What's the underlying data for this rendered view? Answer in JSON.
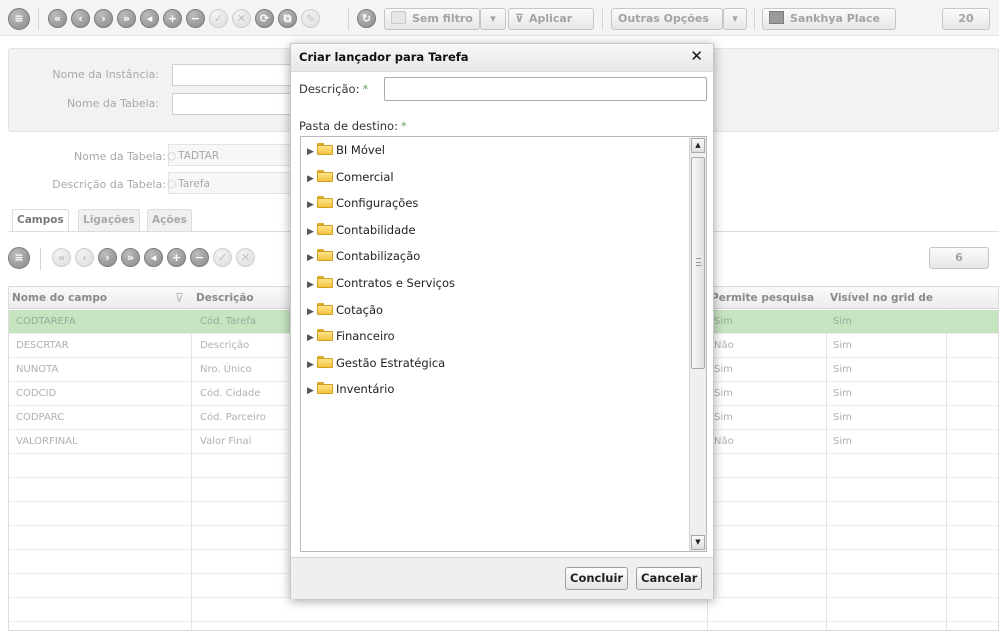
{
  "toolbar": {
    "filter_label": "Sem filtro",
    "apply_label": "Aplicar",
    "more_options_label": "Outras Opções",
    "place_label": "Sankhya Place",
    "page_size": "20"
  },
  "form": {
    "instance_name_label": "Nome da Instância:",
    "table_name_label": "Nome da Tabela:",
    "table_name_label2": "Nome da Tabela:",
    "table_name_value": "TADTAR",
    "table_desc_label": "Descrição da Tabela:",
    "table_desc_value": "Tarefa"
  },
  "tabs": [
    {
      "label": "Campos"
    },
    {
      "label": "Ligações"
    },
    {
      "label": "Ações"
    }
  ],
  "grid": {
    "count": "6",
    "columns": [
      "Nome do campo",
      "Descrição",
      "Permite pesquisa",
      "Visível no grid de"
    ],
    "rows": [
      {
        "campo": "CODTAREFA",
        "descricao": "Cód. Tarefa",
        "pesquisa": "Sim",
        "visivel": "Sim"
      },
      {
        "campo": "DESCRTAR",
        "descricao": "Descrição",
        "pesquisa": "Não",
        "visivel": "Sim"
      },
      {
        "campo": "NUNOTA",
        "descricao": "Nro. Único",
        "pesquisa": "Sim",
        "visivel": "Sim"
      },
      {
        "campo": "CODCID",
        "descricao": "Cód. Cidade",
        "pesquisa": "Sim",
        "visivel": "Sim"
      },
      {
        "campo": "CODPARC",
        "descricao": "Cód. Parceiro",
        "pesquisa": "Sim",
        "visivel": "Sim"
      },
      {
        "campo": "VALORFINAL",
        "descricao": "Valor Final",
        "pesquisa": "Não",
        "visivel": "Sim"
      }
    ]
  },
  "modal": {
    "title": "Criar lançador para Tarefa",
    "description_label": "Descrição:",
    "folder_label": "Pasta de destino:",
    "required_mark": "*",
    "close_glyph": "✕",
    "folders": [
      "BI Móvel",
      "Comercial",
      "Configurações",
      "Contabilidade",
      "Contabilização",
      "Contratos e Serviços",
      "Cotação",
      "Financeiro",
      "Gestão Estratégica",
      "Inventário"
    ],
    "confirm_label": "Concluir",
    "cancel_label": "Cancelar"
  },
  "colors": {
    "selected_row": "#c7e4c1",
    "required_mark": "#6aa36a",
    "folder": "#f2c33d"
  }
}
